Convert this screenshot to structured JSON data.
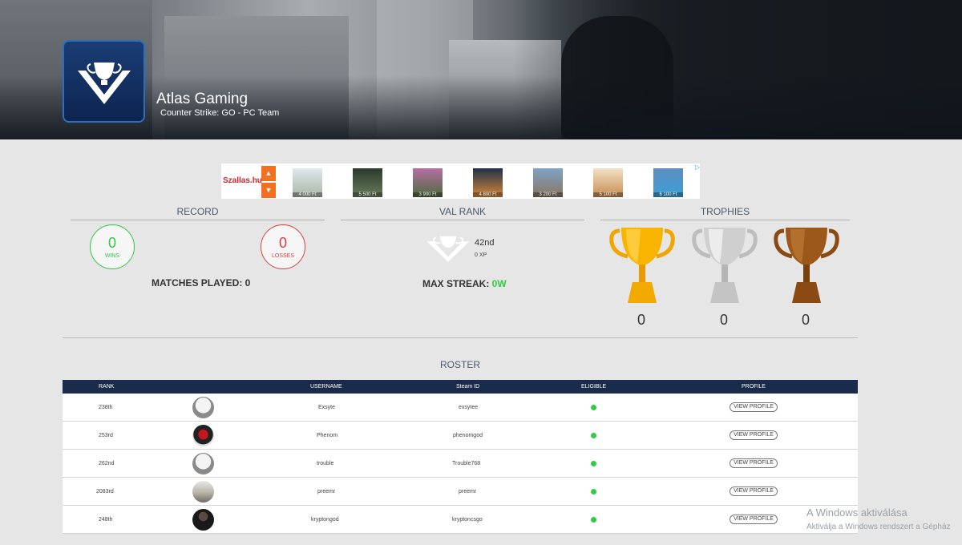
{
  "colors": {
    "accent_navy": "#1b2b4b",
    "win_green": "#34c749",
    "loss_red": "#d94040",
    "eligible_green": "#2ecc40",
    "gold": "#f2a900",
    "silver": "#c8c8c8",
    "bronze": "#8a4a12"
  },
  "team": {
    "name": "Atlas Gaming",
    "subtitle": "Counter Strike: GO - PC Team",
    "logo_icon": "atlas-trophy-logo"
  },
  "ad": {
    "brand": "Szallas.hu",
    "up_arrow": "▲",
    "down_arrow": "▼",
    "adchoices": "▷",
    "prices": [
      "4 000 Ft",
      "5 500 Ft",
      "3 900 Ft",
      "4 800 Ft",
      "3 200 Ft",
      "5 100 Ft",
      "6 100 Ft"
    ]
  },
  "record": {
    "title": "RECORD",
    "wins": "0",
    "wins_label": "WINS",
    "losses": "0",
    "losses_label": "LOSSES",
    "matches_played": "MATCHES PLAYED: 0"
  },
  "val_rank": {
    "title": "VAL RANK",
    "position": "42nd",
    "xp": "0 XP",
    "max_streak_label": "MAX STREAK: ",
    "max_streak_value": "0W"
  },
  "trophies": {
    "title": "TROPHIES",
    "gold_count": "0",
    "silver_count": "0",
    "bronze_count": "0"
  },
  "roster": {
    "title": "ROSTER",
    "headers": {
      "rank": "RANK",
      "username": "USERNAME",
      "steam_id": "Steam ID",
      "eligible": "ELIGIBLE",
      "profile": "PROFILE"
    },
    "rows": [
      {
        "rank": "238th",
        "username": "Exsyte",
        "steam_id": "exsytee",
        "eligible": true,
        "profile": "VIEW PROFILE"
      },
      {
        "rank": "253rd",
        "username": "Phenom",
        "steam_id": "phenomgod",
        "eligible": true,
        "profile": "VIEW PROFILE"
      },
      {
        "rank": "262nd",
        "username": "trouble",
        "steam_id": "Trouble768",
        "eligible": true,
        "profile": "VIEW PROFILE"
      },
      {
        "rank": "2083rd",
        "username": "preemr",
        "steam_id": "preemr",
        "eligible": true,
        "profile": "VIEW PROFILE"
      },
      {
        "rank": "248th",
        "username": "kryptongod",
        "steam_id": "kryptoncsgo",
        "eligible": true,
        "profile": "VIEW PROFILE"
      }
    ]
  },
  "watermark": {
    "line1": "A Windows aktiválása",
    "line2": "Aktiválja a Windows rendszert a Gépház"
  }
}
